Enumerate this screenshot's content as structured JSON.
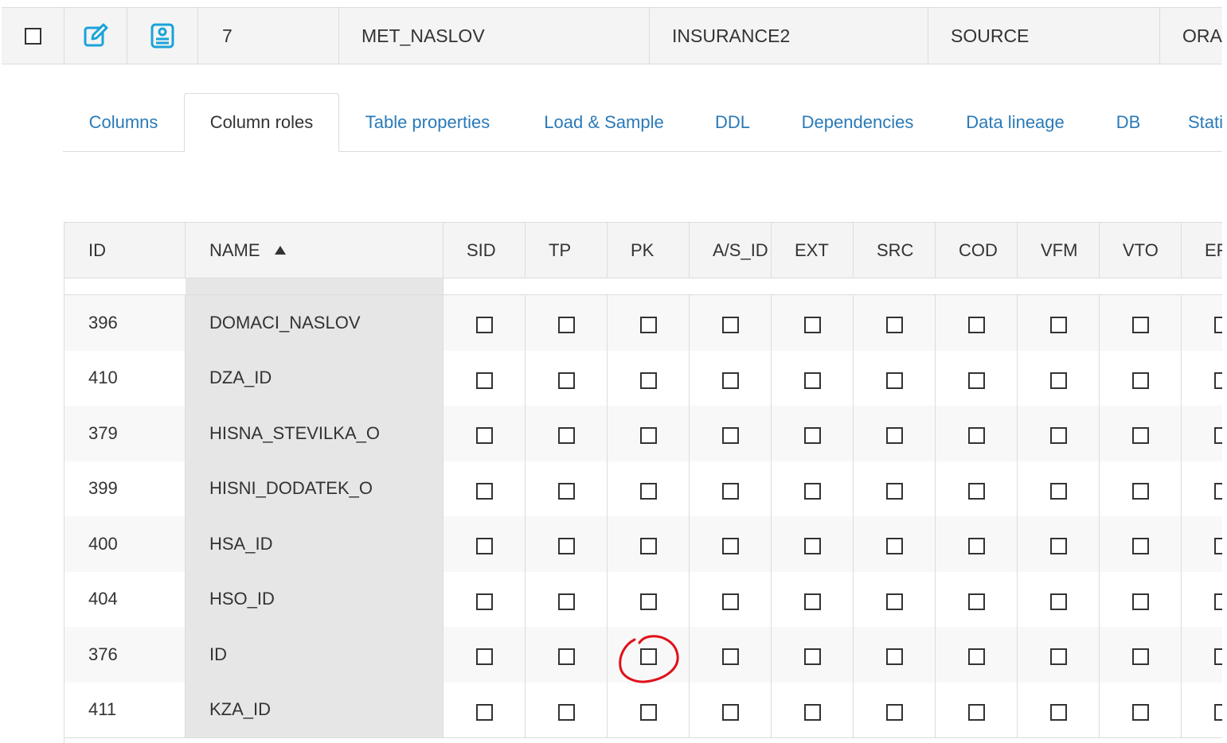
{
  "record": {
    "id": "7",
    "table_name": "MET_NASLOV",
    "schema": "INSURANCE2",
    "role": "SOURCE",
    "db": "ORA",
    "edit_icon": "edit-icon",
    "details_icon": "report-icon"
  },
  "tabs": [
    {
      "label": "Columns",
      "active": false
    },
    {
      "label": "Column roles",
      "active": true
    },
    {
      "label": "Table properties",
      "active": false
    },
    {
      "label": "Load & Sample",
      "active": false
    },
    {
      "label": "DDL",
      "active": false
    },
    {
      "label": "Dependencies",
      "active": false
    },
    {
      "label": "Data lineage",
      "active": false
    },
    {
      "label": "DB",
      "active": false
    },
    {
      "label": "Stati",
      "active": false
    }
  ],
  "grid": {
    "headers": {
      "id": "ID",
      "name": "NAME",
      "roles": [
        "SID",
        "TP",
        "PK",
        "A/S_ID",
        "EXT",
        "SRC",
        "COD",
        "VFM",
        "VTO",
        "EF"
      ]
    },
    "sort": {
      "column": "NAME",
      "direction": "ascending"
    },
    "rows": [
      {
        "id": "396",
        "name": "DOMACI_NASLOV"
      },
      {
        "id": "410",
        "name": "DZA_ID"
      },
      {
        "id": "379",
        "name": "HISNA_STEVILKA_O"
      },
      {
        "id": "399",
        "name": "HISNI_DODATEK_O"
      },
      {
        "id": "400",
        "name": "HSA_ID"
      },
      {
        "id": "404",
        "name": "HSO_ID"
      },
      {
        "id": "376",
        "name": "ID"
      },
      {
        "id": "411",
        "name": "KZA_ID"
      }
    ]
  },
  "colors": {
    "link": "#2a7ab8",
    "icon": "#1aa3d9",
    "annotation": "#e0101a"
  }
}
